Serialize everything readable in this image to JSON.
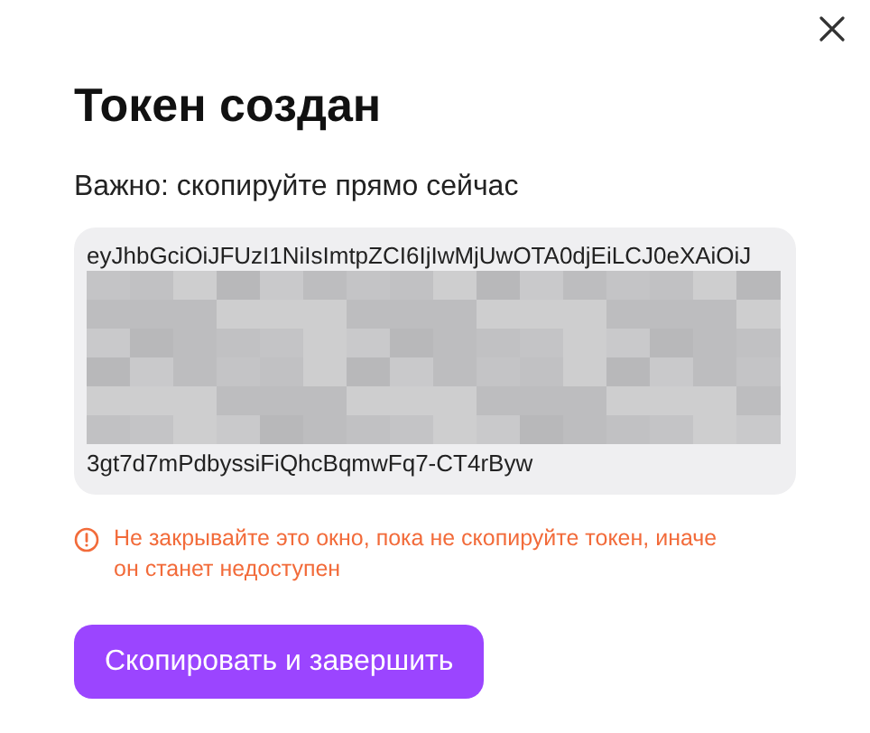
{
  "dialog": {
    "title": "Токен создан",
    "label": "Важно: скопируйте прямо сейчас",
    "token": {
      "first_line": "eyJhbGciOiJFUzI1NiIsImtpZCI6IjIwMjUwOTA0djEiLCJ0eXAiOiJ",
      "last_line": "3gt7d7mPdbyssiFiQhcBqmwFq7-CT4rByw"
    },
    "warning": "Не закрывайте это окно, пока не скопируйте токен, иначе он станет недоступен",
    "button": "Скопировать и завершить"
  }
}
